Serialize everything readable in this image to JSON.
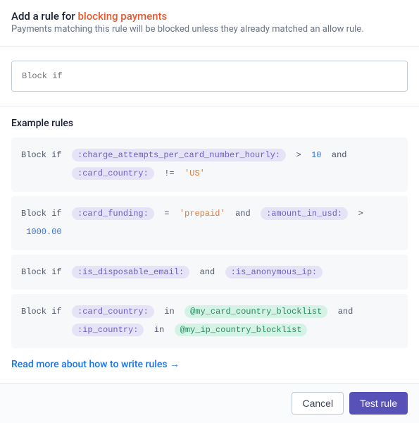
{
  "header": {
    "title_prefix": "Add a rule for ",
    "title_highlight": "blocking payments",
    "subtitle": "Payments matching this rule will be blocked unless they already matched an allow rule."
  },
  "input": {
    "placeholder": "Block if"
  },
  "examples": {
    "title": "Example rules",
    "rules": [
      {
        "prefix": "Block if",
        "tokens_line1": [
          {
            "type": "var",
            "text": ":charge_attempts_per_card_number_hourly:"
          },
          {
            "type": "op",
            "text": ">"
          },
          {
            "type": "num",
            "text": "10"
          },
          {
            "type": "kw",
            "text": "and"
          }
        ],
        "tokens_line2": [
          {
            "type": "var",
            "text": ":card_country:"
          },
          {
            "type": "op",
            "text": "!="
          },
          {
            "type": "str",
            "text": "'US'"
          }
        ]
      },
      {
        "prefix": "Block if",
        "tokens_line1": [
          {
            "type": "var",
            "text": ":card_funding:"
          },
          {
            "type": "op",
            "text": "="
          },
          {
            "type": "str",
            "text": "'prepaid'"
          },
          {
            "type": "kw",
            "text": "and"
          },
          {
            "type": "var",
            "text": ":amount_in_usd:"
          },
          {
            "type": "op",
            "text": ">"
          },
          {
            "type": "num",
            "text": "1000.00"
          }
        ]
      },
      {
        "prefix": "Block if",
        "tokens_line1": [
          {
            "type": "var",
            "text": ":is_disposable_email:"
          },
          {
            "type": "kw",
            "text": "and"
          },
          {
            "type": "var",
            "text": ":is_anonymous_ip:"
          }
        ]
      },
      {
        "prefix": "Block if",
        "tokens_line1": [
          {
            "type": "var",
            "text": ":card_country:"
          },
          {
            "type": "kw",
            "text": "in"
          },
          {
            "type": "list",
            "text": "@my_card_country_blocklist"
          },
          {
            "type": "kw",
            "text": "and"
          }
        ],
        "tokens_line2": [
          {
            "type": "var",
            "text": ":ip_country:"
          },
          {
            "type": "kw",
            "text": "in"
          },
          {
            "type": "list",
            "text": "@my_ip_country_blocklist"
          }
        ]
      }
    ],
    "read_more": "Read more about how to write rules"
  },
  "footer": {
    "cancel": "Cancel",
    "test": "Test rule"
  }
}
